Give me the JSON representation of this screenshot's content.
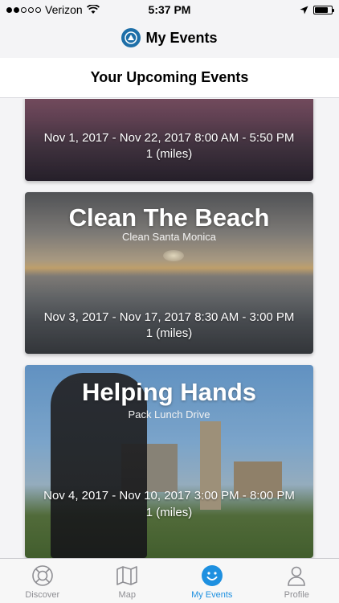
{
  "status_bar": {
    "carrier": "Verizon",
    "time": "5:37 PM",
    "battery_level": 0.8
  },
  "nav": {
    "title": "My Events"
  },
  "section": {
    "title": "Your Upcoming Events"
  },
  "events": [
    {
      "title": "",
      "subtitle": "",
      "dates": "Nov 1, 2017 - Nov 22, 2017 8:00 AM - 5:50 PM",
      "distance": "1 (miles)"
    },
    {
      "title": "Clean The Beach",
      "subtitle": "Clean Santa Monica",
      "dates": "Nov 3, 2017 - Nov 17, 2017 8:30 AM - 3:00 PM",
      "distance": "1 (miles)"
    },
    {
      "title": "Helping Hands",
      "subtitle": "Pack Lunch Drive",
      "dates": "Nov 4, 2017 - Nov 10, 2017 3:00 PM - 8:00 PM",
      "distance": "1 (miles)"
    }
  ],
  "tabs": [
    {
      "label": "Discover",
      "icon": "lifebuoy-icon",
      "active": false
    },
    {
      "label": "Map",
      "icon": "map-icon",
      "active": false
    },
    {
      "label": "My Events",
      "icon": "smiley-icon",
      "active": true
    },
    {
      "label": "Profile",
      "icon": "person-icon",
      "active": false
    }
  ],
  "colors": {
    "accent": "#1e90e0",
    "inactive_tab": "#8e8e93"
  }
}
